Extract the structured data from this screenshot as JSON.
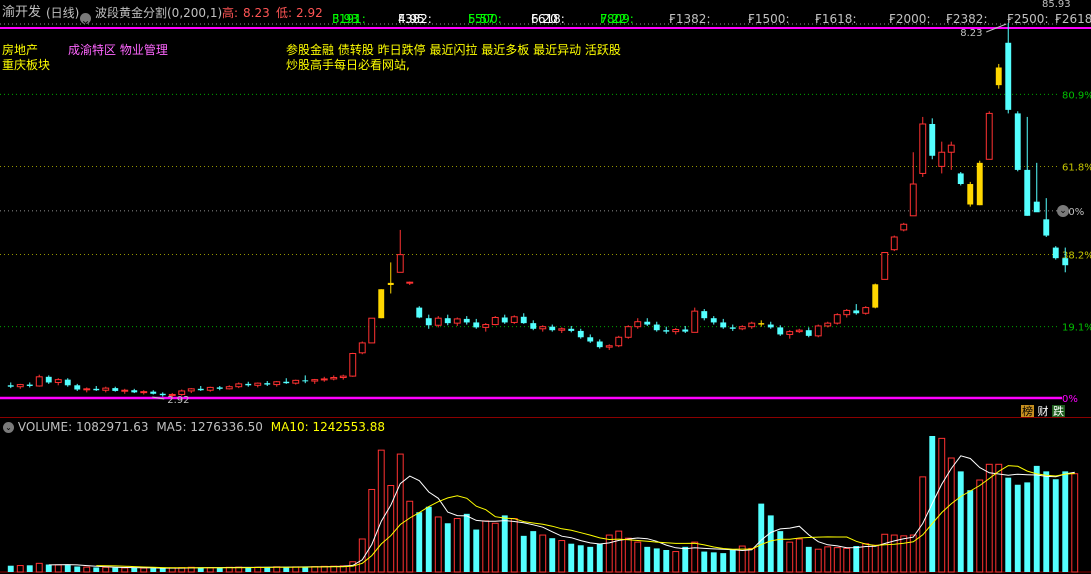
{
  "header": {
    "stock_name": "渝开发",
    "period": "(日线)",
    "indicator": "波段黄金分割(0,200,1)",
    "high_label": "高:",
    "high_value": "8.23",
    "low_label": "低:",
    "low_value": "2.92",
    "fibs": [
      {
        "label": "F191:",
        "value": "3.93"
      },
      {
        "label": "F382:",
        "value": "4.95"
      },
      {
        "label": "F500:",
        "value": "5.57"
      },
      {
        "label": "F618:",
        "value": "6.20"
      },
      {
        "label": "F809:",
        "value": "7.22"
      },
      {
        "label": "F1382:",
        "value": "-"
      },
      {
        "label": "F1500:",
        "value": "-"
      },
      {
        "label": "F1618:",
        "value": "-"
      },
      {
        "label": "F2000:",
        "value": "-"
      },
      {
        "label": "F2382:",
        "value": "-"
      },
      {
        "label": "F2500:",
        "value": "-"
      },
      {
        "label": "F2618:",
        "value": "-"
      },
      {
        "label": "F",
        "value": ""
      }
    ],
    "top_right_price": "85.93"
  },
  "info": {
    "sector": "房地产",
    "region": "重庆板块",
    "concepts": "成渝特区 物业管理",
    "tags_line1": "参股金融 债转股 昨日跌停 最近闪拉 最近多板 最近异动 活跃股",
    "tags_line2": "炒股高手每日必看网站,"
  },
  "price_annotations": {
    "high_marker": "8.23",
    "low_marker": "2.92"
  },
  "fib_levels": [
    {
      "label": "80.9%",
      "price": 7.22,
      "color": "#00c000"
    },
    {
      "label": "61.8%",
      "price": 6.2,
      "color": "#c8c800"
    },
    {
      "label": "50%",
      "price": 5.57,
      "color": "#c0c0c0"
    },
    {
      "label": "38.2%",
      "price": 4.95,
      "color": "#c8c800"
    },
    {
      "label": "19.1%",
      "price": 3.93,
      "color": "#00c000"
    },
    {
      "label": "0%",
      "price": 2.92,
      "color": "#ff00ff"
    }
  ],
  "rank_buttons": {
    "rank": "榜",
    "limit_down": "跌"
  },
  "volume_header": {
    "title": "VOLUME:",
    "value": "1082971.63",
    "ma5_label": "MA5:",
    "ma5_value": "1276336.50",
    "ma10_label": "MA10:",
    "ma10_value": "1242553.88"
  },
  "colors": {
    "up": "#ff3232",
    "down": "#54ffff",
    "limit_up": "#ffd700",
    "ma5": "#ffffff",
    "ma10": "#ffff00",
    "magenta": "#ff00ff"
  },
  "chart_data": {
    "type": "candlestick",
    "price_range": [
      2.92,
      8.23
    ],
    "candles": [
      {
        "o": 3.1,
        "h": 3.14,
        "l": 3.06,
        "c": 3.08
      },
      {
        "o": 3.08,
        "h": 3.12,
        "l": 3.05,
        "c": 3.11
      },
      {
        "o": 3.11,
        "h": 3.14,
        "l": 3.07,
        "c": 3.09
      },
      {
        "o": 3.09,
        "h": 3.25,
        "l": 3.08,
        "c": 3.22
      },
      {
        "o": 3.22,
        "h": 3.24,
        "l": 3.12,
        "c": 3.14
      },
      {
        "o": 3.14,
        "h": 3.2,
        "l": 3.1,
        "c": 3.18
      },
      {
        "o": 3.18,
        "h": 3.2,
        "l": 3.08,
        "c": 3.1
      },
      {
        "o": 3.1,
        "h": 3.12,
        "l": 3.02,
        "c": 3.04
      },
      {
        "o": 3.04,
        "h": 3.07,
        "l": 3.0,
        "c": 3.05
      },
      {
        "o": 3.05,
        "h": 3.09,
        "l": 3.02,
        "c": 3.03
      },
      {
        "o": 3.03,
        "h": 3.08,
        "l": 3.0,
        "c": 3.06
      },
      {
        "o": 3.06,
        "h": 3.08,
        "l": 3.01,
        "c": 3.02
      },
      {
        "o": 3.02,
        "h": 3.05,
        "l": 2.98,
        "c": 3.03
      },
      {
        "o": 3.03,
        "h": 3.05,
        "l": 2.99,
        "c": 3.0
      },
      {
        "o": 3.0,
        "h": 3.03,
        "l": 2.97,
        "c": 3.01
      },
      {
        "o": 3.01,
        "h": 3.03,
        "l": 2.97,
        "c": 2.98
      },
      {
        "o": 2.98,
        "h": 3.0,
        "l": 2.94,
        "c": 2.96
      },
      {
        "o": 2.96,
        "h": 2.99,
        "l": 2.92,
        "c": 2.97
      },
      {
        "o": 2.97,
        "h": 3.04,
        "l": 2.95,
        "c": 3.02
      },
      {
        "o": 3.02,
        "h": 3.06,
        "l": 2.99,
        "c": 3.05
      },
      {
        "o": 3.05,
        "h": 3.09,
        "l": 3.02,
        "c": 3.03
      },
      {
        "o": 3.03,
        "h": 3.08,
        "l": 3.01,
        "c": 3.07
      },
      {
        "o": 3.07,
        "h": 3.09,
        "l": 3.03,
        "c": 3.05
      },
      {
        "o": 3.05,
        "h": 3.1,
        "l": 3.04,
        "c": 3.08
      },
      {
        "o": 3.08,
        "h": 3.14,
        "l": 3.06,
        "c": 3.12
      },
      {
        "o": 3.12,
        "h": 3.15,
        "l": 3.08,
        "c": 3.1
      },
      {
        "o": 3.1,
        "h": 3.14,
        "l": 3.07,
        "c": 3.13
      },
      {
        "o": 3.13,
        "h": 3.16,
        "l": 3.09,
        "c": 3.11
      },
      {
        "o": 3.11,
        "h": 3.16,
        "l": 3.08,
        "c": 3.15
      },
      {
        "o": 3.15,
        "h": 3.2,
        "l": 3.12,
        "c": 3.13
      },
      {
        "o": 3.13,
        "h": 3.18,
        "l": 3.11,
        "c": 3.17
      },
      {
        "o": 3.17,
        "h": 3.24,
        "l": 3.13,
        "c": 3.16
      },
      {
        "o": 3.16,
        "h": 3.19,
        "l": 3.12,
        "c": 3.18
      },
      {
        "o": 3.18,
        "h": 3.22,
        "l": 3.15,
        "c": 3.19
      },
      {
        "o": 3.19,
        "h": 3.24,
        "l": 3.17,
        "c": 3.21
      },
      {
        "o": 3.21,
        "h": 3.25,
        "l": 3.18,
        "c": 3.23
      },
      {
        "o": 3.23,
        "h": 3.56,
        "l": 3.22,
        "c": 3.55
      },
      {
        "o": 3.56,
        "h": 3.72,
        "l": 3.54,
        "c": 3.7
      },
      {
        "o": 3.7,
        "h": 4.05,
        "l": 3.7,
        "c": 4.05
      },
      {
        "o": 4.05,
        "h": 4.46,
        "l": 4.05,
        "c": 4.46
      },
      {
        "o": 4.52,
        "h": 4.84,
        "l": 4.4,
        "c": 4.55
      },
      {
        "o": 4.7,
        "h": 5.3,
        "l": 4.7,
        "c": 4.95
      },
      {
        "o": 4.55,
        "h": 4.57,
        "l": 4.52,
        "c": 4.56
      },
      {
        "o": 4.2,
        "h": 4.22,
        "l": 4.05,
        "c": 4.06
      },
      {
        "o": 4.05,
        "h": 4.1,
        "l": 3.9,
        "c": 3.95
      },
      {
        "o": 3.95,
        "h": 4.08,
        "l": 3.92,
        "c": 4.05
      },
      {
        "o": 4.05,
        "h": 4.1,
        "l": 3.95,
        "c": 3.98
      },
      {
        "o": 3.98,
        "h": 4.06,
        "l": 3.94,
        "c": 4.04
      },
      {
        "o": 4.04,
        "h": 4.08,
        "l": 3.96,
        "c": 3.99
      },
      {
        "o": 3.99,
        "h": 4.04,
        "l": 3.9,
        "c": 3.92
      },
      {
        "o": 3.92,
        "h": 3.98,
        "l": 3.86,
        "c": 3.96
      },
      {
        "o": 3.96,
        "h": 4.08,
        "l": 3.95,
        "c": 4.06
      },
      {
        "o": 4.06,
        "h": 4.1,
        "l": 3.97,
        "c": 3.99
      },
      {
        "o": 3.99,
        "h": 4.09,
        "l": 3.97,
        "c": 4.07
      },
      {
        "o": 4.07,
        "h": 4.12,
        "l": 3.97,
        "c": 3.98
      },
      {
        "o": 3.98,
        "h": 4.02,
        "l": 3.88,
        "c": 3.9
      },
      {
        "o": 3.9,
        "h": 3.95,
        "l": 3.86,
        "c": 3.93
      },
      {
        "o": 3.93,
        "h": 3.96,
        "l": 3.86,
        "c": 3.88
      },
      {
        "o": 3.88,
        "h": 3.92,
        "l": 3.84,
        "c": 3.9
      },
      {
        "o": 3.9,
        "h": 3.94,
        "l": 3.85,
        "c": 3.87
      },
      {
        "o": 3.87,
        "h": 3.9,
        "l": 3.76,
        "c": 3.78
      },
      {
        "o": 3.78,
        "h": 3.82,
        "l": 3.7,
        "c": 3.72
      },
      {
        "o": 3.72,
        "h": 3.75,
        "l": 3.62,
        "c": 3.64
      },
      {
        "o": 3.64,
        "h": 3.68,
        "l": 3.6,
        "c": 3.66
      },
      {
        "o": 3.66,
        "h": 3.8,
        "l": 3.64,
        "c": 3.78
      },
      {
        "o": 3.78,
        "h": 3.95,
        "l": 3.76,
        "c": 3.93
      },
      {
        "o": 3.93,
        "h": 4.05,
        "l": 3.9,
        "c": 4.0
      },
      {
        "o": 4.0,
        "h": 4.05,
        "l": 3.94,
        "c": 3.96
      },
      {
        "o": 3.96,
        "h": 4.0,
        "l": 3.86,
        "c": 3.88
      },
      {
        "o": 3.88,
        "h": 3.93,
        "l": 3.83,
        "c": 3.86
      },
      {
        "o": 3.86,
        "h": 3.91,
        "l": 3.82,
        "c": 3.89
      },
      {
        "o": 3.89,
        "h": 3.94,
        "l": 3.84,
        "c": 3.86
      },
      {
        "o": 3.85,
        "h": 4.2,
        "l": 3.85,
        "c": 4.15
      },
      {
        "o": 4.15,
        "h": 4.18,
        "l": 4.02,
        "c": 4.05
      },
      {
        "o": 4.05,
        "h": 4.08,
        "l": 3.96,
        "c": 3.99
      },
      {
        "o": 3.99,
        "h": 4.04,
        "l": 3.9,
        "c": 3.92
      },
      {
        "o": 3.92,
        "h": 3.96,
        "l": 3.87,
        "c": 3.9
      },
      {
        "o": 3.9,
        "h": 3.95,
        "l": 3.88,
        "c": 3.93
      },
      {
        "o": 3.93,
        "h": 4.0,
        "l": 3.9,
        "c": 3.98
      },
      {
        "o": 3.98,
        "h": 4.02,
        "l": 3.93,
        "c": 3.96
      },
      {
        "o": 3.96,
        "h": 4.0,
        "l": 3.9,
        "c": 3.92
      },
      {
        "o": 3.92,
        "h": 3.95,
        "l": 3.8,
        "c": 3.82
      },
      {
        "o": 3.82,
        "h": 3.88,
        "l": 3.76,
        "c": 3.86
      },
      {
        "o": 3.86,
        "h": 3.9,
        "l": 3.84,
        "c": 3.88
      },
      {
        "o": 3.88,
        "h": 3.92,
        "l": 3.78,
        "c": 3.8
      },
      {
        "o": 3.8,
        "h": 3.96,
        "l": 3.78,
        "c": 3.94
      },
      {
        "o": 3.94,
        "h": 4.0,
        "l": 3.92,
        "c": 3.98
      },
      {
        "o": 3.98,
        "h": 4.12,
        "l": 3.96,
        "c": 4.1
      },
      {
        "o": 4.1,
        "h": 4.18,
        "l": 4.06,
        "c": 4.16
      },
      {
        "o": 4.16,
        "h": 4.25,
        "l": 4.1,
        "c": 4.12
      },
      {
        "o": 4.12,
        "h": 4.22,
        "l": 4.1,
        "c": 4.2
      },
      {
        "o": 4.2,
        "h": 4.54,
        "l": 4.19,
        "c": 4.53
      },
      {
        "o": 4.6,
        "h": 4.98,
        "l": 4.6,
        "c": 4.98
      },
      {
        "o": 5.02,
        "h": 5.22,
        "l": 5.0,
        "c": 5.2
      },
      {
        "o": 5.3,
        "h": 5.4,
        "l": 5.28,
        "c": 5.38
      },
      {
        "o": 5.5,
        "h": 6.4,
        "l": 5.95,
        "c": 5.95
      },
      {
        "o": 6.1,
        "h": 6.9,
        "l": 6.05,
        "c": 6.8
      },
      {
        "o": 6.8,
        "h": 6.88,
        "l": 6.3,
        "c": 6.35
      },
      {
        "o": 6.2,
        "h": 6.55,
        "l": 6.1,
        "c": 6.4
      },
      {
        "o": 6.4,
        "h": 6.55,
        "l": 6.15,
        "c": 6.5
      },
      {
        "o": 6.1,
        "h": 6.12,
        "l": 5.93,
        "c": 5.95
      },
      {
        "o": 5.95,
        "h": 5.98,
        "l": 5.63,
        "c": 5.66
      },
      {
        "o": 5.65,
        "h": 6.28,
        "l": 5.65,
        "c": 6.25
      },
      {
        "o": 6.3,
        "h": 6.98,
        "l": 6.3,
        "c": 6.95
      },
      {
        "o": 7.35,
        "h": 7.65,
        "l": 7.3,
        "c": 7.6
      },
      {
        "o": 7.95,
        "h": 8.23,
        "l": 6.95,
        "c": 7.0
      },
      {
        "o": 6.95,
        "h": 6.98,
        "l": 6.13,
        "c": 6.15
      },
      {
        "o": 6.15,
        "h": 6.9,
        "l": 5.5,
        "c": 5.5
      },
      {
        "o": 5.7,
        "h": 6.25,
        "l": 5.65,
        "c": 5.55
      },
      {
        "o": 5.45,
        "h": 5.75,
        "l": 5.2,
        "c": 5.22
      },
      {
        "o": 5.05,
        "h": 5.07,
        "l": 4.88,
        "c": 4.9
      },
      {
        "o": 4.9,
        "h": 5.05,
        "l": 4.7,
        "c": 4.8
      }
    ],
    "limit_up_days": [
      39,
      40,
      79,
      91,
      101,
      102,
      104
    ],
    "volume": {
      "max": 1730000,
      "values": [
        80000,
        82000,
        85000,
        110000,
        95000,
        90000,
        88000,
        70000,
        62000,
        58000,
        60000,
        56000,
        52000,
        54000,
        50000,
        48000,
        45000,
        52000,
        55000,
        60000,
        58000,
        54000,
        56000,
        60000,
        62000,
        58000,
        60000,
        64000,
        66000,
        62000,
        65000,
        70000,
        68000,
        72000,
        74000,
        78000,
        130000,
        420000,
        1050000,
        1550000,
        1100000,
        1500000,
        900000,
        760000,
        830000,
        700000,
        620000,
        680000,
        740000,
        540000,
        650000,
        620000,
        720000,
        680000,
        460000,
        520000,
        470000,
        430000,
        400000,
        360000,
        340000,
        320000,
        360000,
        470000,
        520000,
        430000,
        380000,
        320000,
        300000,
        280000,
        260000,
        320000,
        380000,
        260000,
        250000,
        240000,
        290000,
        330000,
        300000,
        870000,
        720000,
        520000,
        380000,
        420000,
        320000,
        290000,
        320000,
        310000,
        300000,
        330000,
        360000,
        340000,
        480000,
        470000,
        460000,
        470000,
        1210000,
        1750000,
        1700000,
        1450000,
        1280000,
        1040000,
        1170000,
        1370000,
        1370000,
        1200000,
        1110000,
        1140000,
        1350000,
        1280000,
        1180000,
        1280000,
        1250000
      ]
    },
    "ma5": [
      1280000,
      1120000,
      1000000,
      980000,
      1180000,
      1390000,
      1310000,
      1200000,
      1120000,
      1310000,
      1290000,
      1250000,
      1276000
    ],
    "ma10": [
      1150000,
      1140000,
      1110000,
      1160000,
      1250000,
      1250000,
      1220000,
      1190000,
      1210000,
      1250000,
      1270000,
      1242000
    ]
  }
}
